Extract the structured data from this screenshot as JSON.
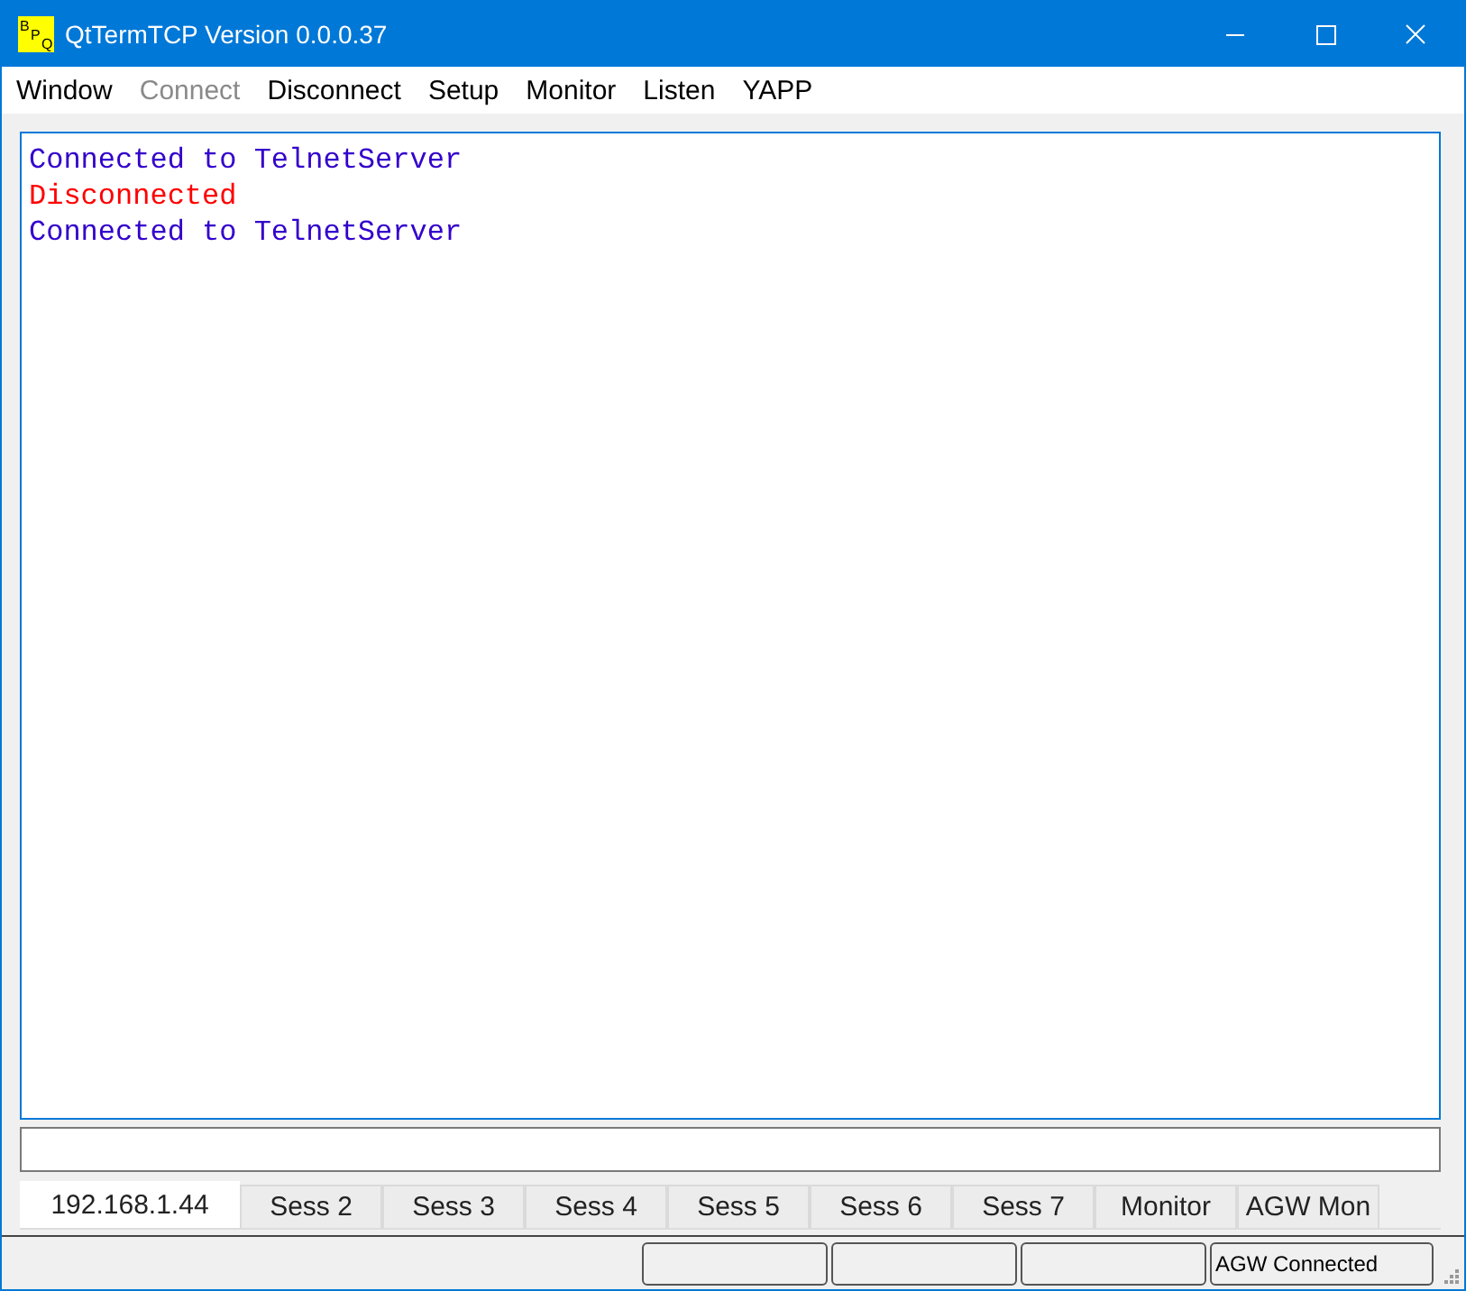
{
  "window": {
    "logo": "BPQ",
    "title": "QtTermTCP Version 0.0.0.37"
  },
  "menu": [
    {
      "label": "Window",
      "disabled": false
    },
    {
      "label": "Connect",
      "disabled": true
    },
    {
      "label": "Disconnect",
      "disabled": false
    },
    {
      "label": "Setup",
      "disabled": false
    },
    {
      "label": "Monitor",
      "disabled": false
    },
    {
      "label": "Listen",
      "disabled": false
    },
    {
      "label": "YAPP",
      "disabled": false
    }
  ],
  "terminal": {
    "lines": [
      {
        "text": "Connected to TelnetServer",
        "color": "#3300cc"
      },
      {
        "text": "Disconnected",
        "color": "#ff0000"
      },
      {
        "text": "Connected to TelnetServer",
        "color": "#3300cc"
      }
    ]
  },
  "tabs": [
    {
      "label": "192.168.1.44",
      "selected": true
    },
    {
      "label": "Sess 2",
      "selected": false
    },
    {
      "label": "Sess 3",
      "selected": false
    },
    {
      "label": "Sess 4",
      "selected": false
    },
    {
      "label": "Sess 5",
      "selected": false
    },
    {
      "label": "Sess 6",
      "selected": false
    },
    {
      "label": "Sess 7",
      "selected": false
    },
    {
      "label": "Monitor",
      "selected": false
    },
    {
      "label": "AGW Mon",
      "selected": false
    }
  ],
  "status_bar": {
    "agw_status": "AGW Connected"
  }
}
